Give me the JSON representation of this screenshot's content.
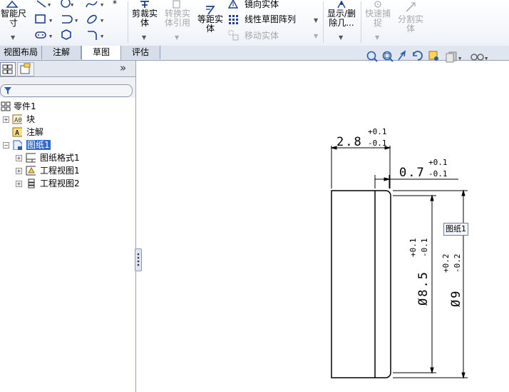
{
  "ribbon": {
    "smart_dimension": "智能尺\n寸",
    "trim": "剪裁实\n体",
    "convert": "转换实\n体引用",
    "offset": "等距实\n体",
    "mirror": "镜向实体",
    "linear_pattern": "线性草图阵列",
    "move": "移动实体",
    "show_delete": "显示/删\n除几...",
    "quick_snap": "快速捕\n捉",
    "split": "分割实\n体"
  },
  "tabs": [
    "视图布局",
    "注解",
    "草图",
    "评估"
  ],
  "active_tab": "草图",
  "panel": {
    "expand_glyph": "»",
    "tree": [
      {
        "label": "零件1",
        "icon": "part-icon"
      },
      {
        "label": "块",
        "icon": "block-icon"
      },
      {
        "label": "注解",
        "icon": "annotation-icon"
      },
      {
        "label": "图纸1",
        "icon": "sheet-icon",
        "selected": true
      },
      {
        "label": "图纸格式1",
        "icon": "sheet-format-icon"
      },
      {
        "label": "工程视图1",
        "icon": "drawing-view-icon"
      },
      {
        "label": "工程视图2",
        "icon": "drawing-view2-icon"
      }
    ]
  },
  "drawing": {
    "dim_width": "2.8",
    "dim_width_tol_upper": "+0.1",
    "dim_width_tol_lower": "-0.1",
    "dim_chamfer": "0.7",
    "dim_chamfer_tol_upper": "+0.1",
    "dim_chamfer_tol_lower": "-0.1",
    "dim_inner_dia": "Ø8.5",
    "dim_inner_tol_upper": "+0.1",
    "dim_inner_tol_lower": "-0.1",
    "dim_outer_dia": "Ø9",
    "dim_outer_tol_upper": "+0.2",
    "dim_outer_tol_lower": "-0.2",
    "sheet_tag": "图纸1"
  }
}
